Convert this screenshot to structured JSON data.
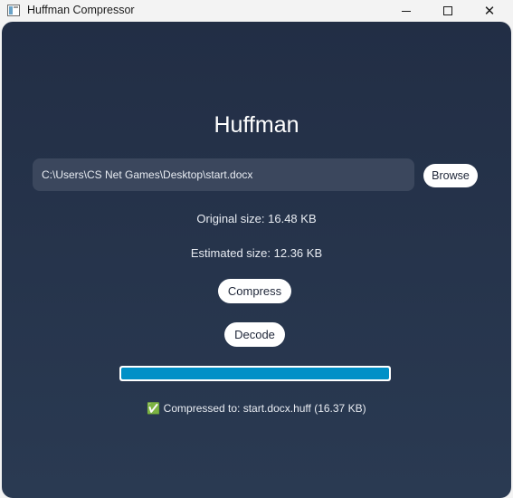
{
  "window": {
    "title": "Huffman Compressor",
    "controls": {
      "minimize_icon": "minimize-icon",
      "maximize_icon": "maximize-icon",
      "close_icon": "close-icon",
      "close_glyph": "✕"
    }
  },
  "main": {
    "heading": "Huffman",
    "file_path": "C:\\Users\\CS Net Games\\Desktop\\start.docx",
    "browse_label": "Browse",
    "original_size": "Original size: 16.48 KB",
    "estimated_size": "Estimated size: 12.36 KB",
    "compress_label": "Compress",
    "decode_label": "Decode",
    "progress_fraction": 1.0,
    "status": "✅ Compressed to: start.docx.huff (16.37 KB)"
  },
  "colors": {
    "background_top": "#222e45",
    "background_bottom": "#2a3a52",
    "field": "#3b475d",
    "progress_fill": "#0090c7"
  }
}
